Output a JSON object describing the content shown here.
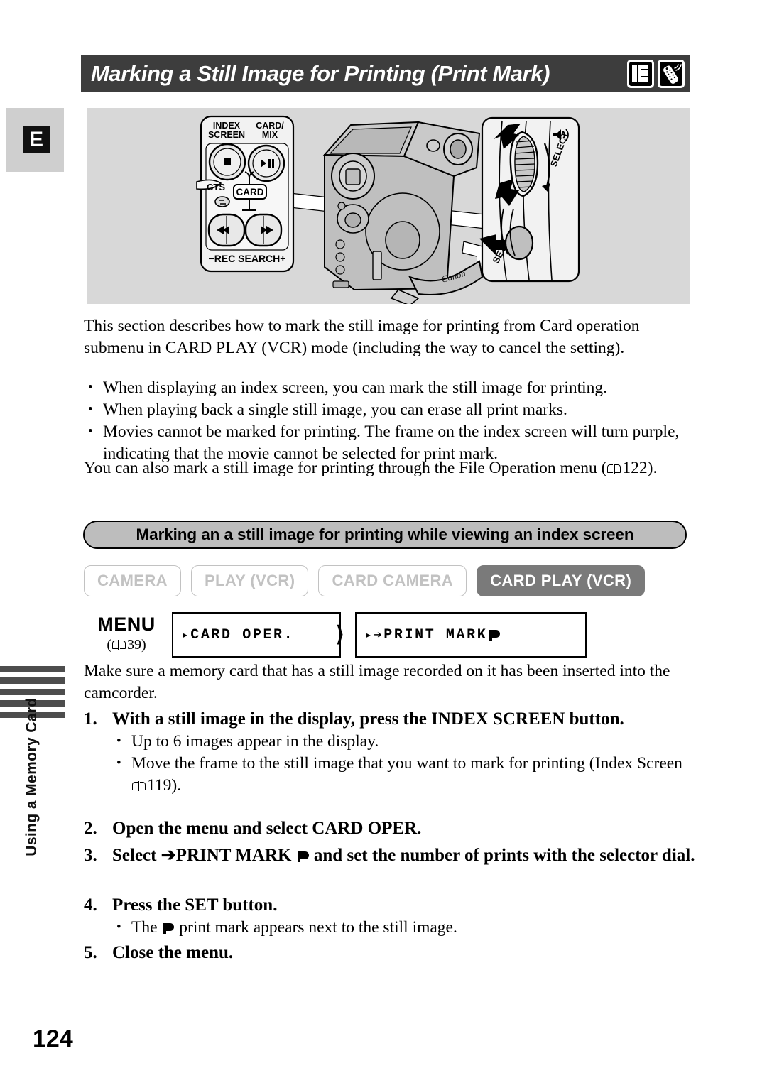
{
  "page": {
    "number": "124",
    "language_tab": "E",
    "chapter_title": "Using a Memory Card"
  },
  "header": {
    "title": "Marking a Still Image for Printing (Print Mark)",
    "icons": [
      "memory-card-icon",
      "remote-control-icon"
    ]
  },
  "illustration": {
    "alt": "camcorder-with-callouts",
    "callout_left": {
      "labels": [
        "INDEX",
        "SCREEN",
        "CARD/",
        "MIX",
        "CTS",
        "CARD",
        "REC SEARCH"
      ],
      "label_index_screen_line1": "INDEX",
      "label_index_screen_line2": "SCREEN",
      "label_card_mix_line1": "CARD/",
      "label_card_mix_line2": "MIX",
      "label_cts": "CTS",
      "label_card": "CARD",
      "label_rec_search": "REC SEARCH",
      "label_minus": "−",
      "label_plus": "+",
      "button_stop": "■",
      "button_play_pause": "▶/❙❙",
      "button_rewind": "◀◀",
      "button_forward": "▶▶"
    },
    "callout_right": {
      "label_select": "SELECT",
      "label_set": "SET",
      "icon_volume": "speaker-icon"
    },
    "brand": "Canon"
  },
  "intro": {
    "paragraph": "This section describes how to mark the still image for printing from Card operation submenu in CARD PLAY (VCR) mode (including the way to cancel the setting).",
    "bullets": [
      "When displaying an index screen, you can mark the still image for printing.",
      "When playing back a single still image, you can erase all print marks.",
      "Movies cannot be marked for printing. The frame on the index screen will turn purple, indicating that the movie cannot be selected for print mark."
    ],
    "after_bullets_before_ref": "You can also mark a still image for printing through the File Operation menu (",
    "after_bullets_page_ref": "122",
    "after_bullets_after_ref": ")."
  },
  "section": {
    "heading": "Marking an a still image for printing while viewing an index screen",
    "modes": [
      {
        "label": "CAMERA",
        "active": false
      },
      {
        "label": "PLAY (VCR)",
        "active": false
      },
      {
        "label": "CARD CAMERA",
        "active": false
      },
      {
        "label": "CARD PLAY (VCR)",
        "active": true
      }
    ]
  },
  "menu": {
    "label": "MENU",
    "ref_open": "(",
    "ref_page": "39",
    "ref_close": ")",
    "box1": {
      "marker": "▸",
      "text": "CARD OPER."
    },
    "chevron": "⟩",
    "box2": {
      "marker": "▸",
      "arrow": "➔",
      "text": "PRINT MARK",
      "glyph": "print-mark-icon"
    }
  },
  "body": {
    "make_sure": "Make sure a memory card that has a still image recorded on it has been inserted into the camcorder.",
    "steps": [
      {
        "num": "1.",
        "heading": "With a still image in the display, press the INDEX SCREEN button.",
        "bullets": [
          "Up to 6 images appear in the display.",
          "Move the frame to the still image that you want to mark for printing (Index Screen"
        ],
        "bullet2_page_ref": "119",
        "bullet2_tail": ")."
      },
      {
        "num": "2.",
        "heading": "Open the menu and select CARD OPER."
      },
      {
        "num": "3.",
        "heading_part1": "Select",
        "heading_arrow": "➔",
        "heading_part2": "PRINT MARK",
        "heading_glyph": "print-mark-icon",
        "heading_part3": "and set the number of prints with the selector dial."
      },
      {
        "num": "4.",
        "heading": "Press the SET button.",
        "bullet_part1": "The",
        "bullet_glyph": "print-mark-icon",
        "bullet_part2": "print mark appears next to the still image."
      },
      {
        "num": "5.",
        "heading": "Close the menu."
      }
    ]
  },
  "colors": {
    "title_bar": "#3d3d3d",
    "illustration_bg": "#d8d8d8",
    "section_band": "#bdbdbd",
    "mode_active": "#7a7a7a",
    "mode_inactive_text": "#c2c2c2",
    "chapter_bar": "#4d4d4d"
  }
}
